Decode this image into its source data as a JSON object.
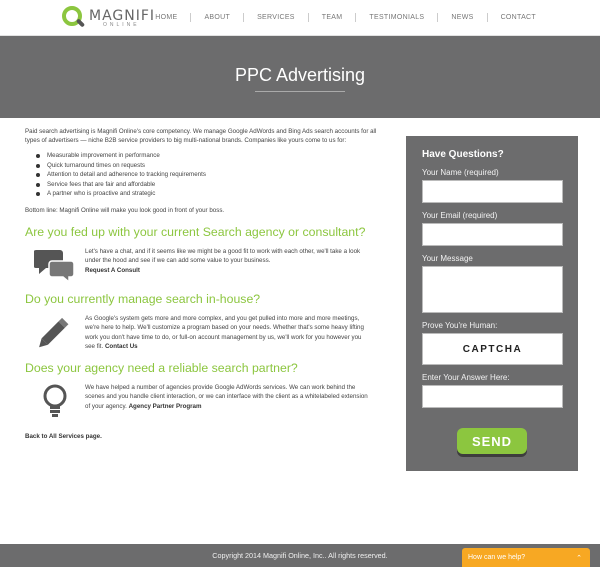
{
  "logo": {
    "name": "MAGNIFI",
    "sub": "ONLINE"
  },
  "nav": [
    "HOME",
    "ABOUT",
    "SERVICES",
    "TEAM",
    "TESTIMONIALS",
    "NEWS",
    "CONTACT"
  ],
  "banner": {
    "title": "PPC Advertising"
  },
  "main": {
    "intro": "Paid search advertising is Magnifi Online's core competency. We manage Google AdWords and Bing Ads search accounts for all types of advertisers — niche B2B service providers to big multi-national brands. Companies like yours come to us for:",
    "bullets": [
      "Measurable improvement in performance",
      "Quick turnaround times on requests",
      "Attention to detail and adherence to tracking requirements",
      "Service fees that are fair and affordable",
      "A partner who is proactive and strategic"
    ],
    "bottom_line": "Bottom line: Magnifi Online will make you look good in front of your boss.",
    "sections": [
      {
        "heading": "Are you fed up with your current Search agency or consultant?",
        "text": "Let's have a chat, and if it seems like we might be a good fit to work with each other, we'll take a look under the hood and see if we can add some value to your business.",
        "link": "Request A Consult",
        "icon": "chat-bubbles-icon"
      },
      {
        "heading": "Do you currently manage search in-house?",
        "text": "As Google's system gets more and more complex, and you get pulled into more and more meetings, we're here to help. We'll customize a program based on your needs. Whether that's some heavy lifting work you don't have time to do, or full-on account management by us, we'll work for you however you see fit.",
        "link": "Contact Us",
        "icon": "pencil-icon"
      },
      {
        "heading": "Does your agency need a reliable search partner?",
        "text": "We have helped a number of agencies provide Google AdWords services. We can work behind the scenes and you handle client interaction, or we can interface with the client as a whitelabeled extension of your agency.",
        "link": "Agency Partner Program",
        "icon": "lightbulb-icon"
      }
    ],
    "back": "Back to All Services page."
  },
  "form": {
    "title": "Have Questions?",
    "name_label": "Your Name (required)",
    "email_label": "Your Email (required)",
    "message_label": "Your Message",
    "human_label": "Prove You're Human:",
    "captcha": "CAPTCHA",
    "answer_label": "Enter Your Answer Here:",
    "send": "SEND"
  },
  "footer": {
    "copyright": "Copyright 2014 Magnifi Online, Inc.. All rights reserved."
  },
  "chat": {
    "label": "How can we help?",
    "icon": "chevron-up-icon"
  },
  "colors": {
    "accent": "#8cc63f",
    "panel": "#6c6c6d",
    "chat": "#f7a823"
  }
}
